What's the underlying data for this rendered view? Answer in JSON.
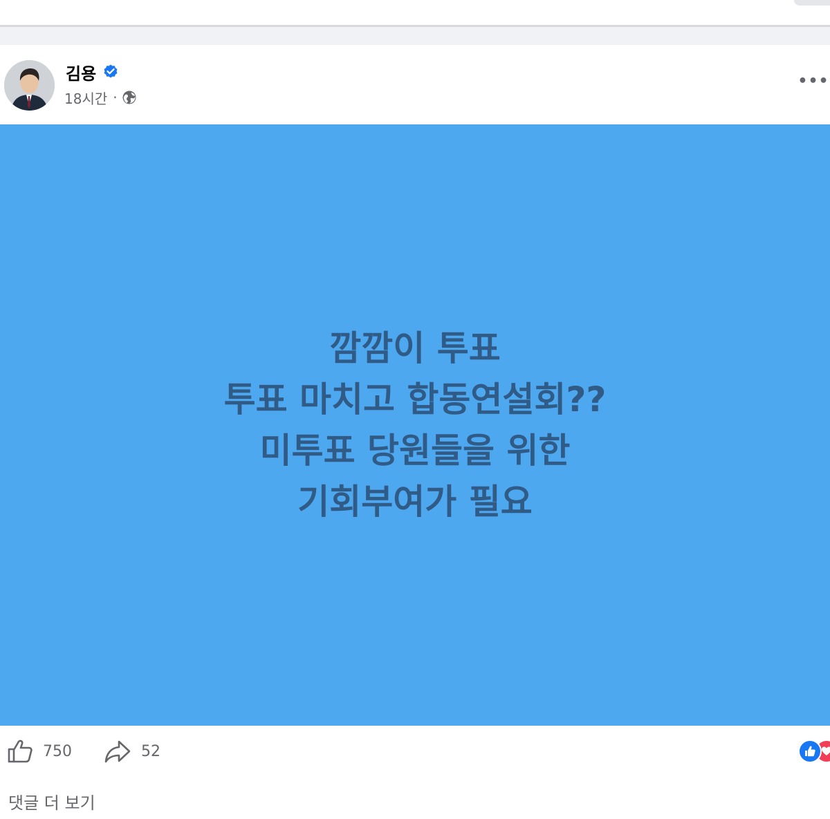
{
  "post": {
    "author_name": "김용",
    "timestamp": "18시간",
    "separator": "·",
    "privacy_icon": "globe-icon",
    "verified_icon": "verified-badge-icon",
    "more_label": "•••",
    "text_lines": [
      "깜깜이 투표",
      "투표 마치고 합동연설회??",
      "미투표 당원들을 위한",
      "기회부여가 필요"
    ],
    "background_color": "#4ea8f0",
    "text_color": "#2f5b86"
  },
  "footer": {
    "like_count": "750",
    "share_count": "52",
    "more_comments_label": "댓글 더 보기",
    "reaction_icons": [
      "like-reaction-icon",
      "love-reaction-icon"
    ]
  },
  "colors": {
    "verified": "#1877f2",
    "secondary_text": "#65676b",
    "like_reaction": "#1877f2",
    "love_reaction": "#f33e58"
  }
}
